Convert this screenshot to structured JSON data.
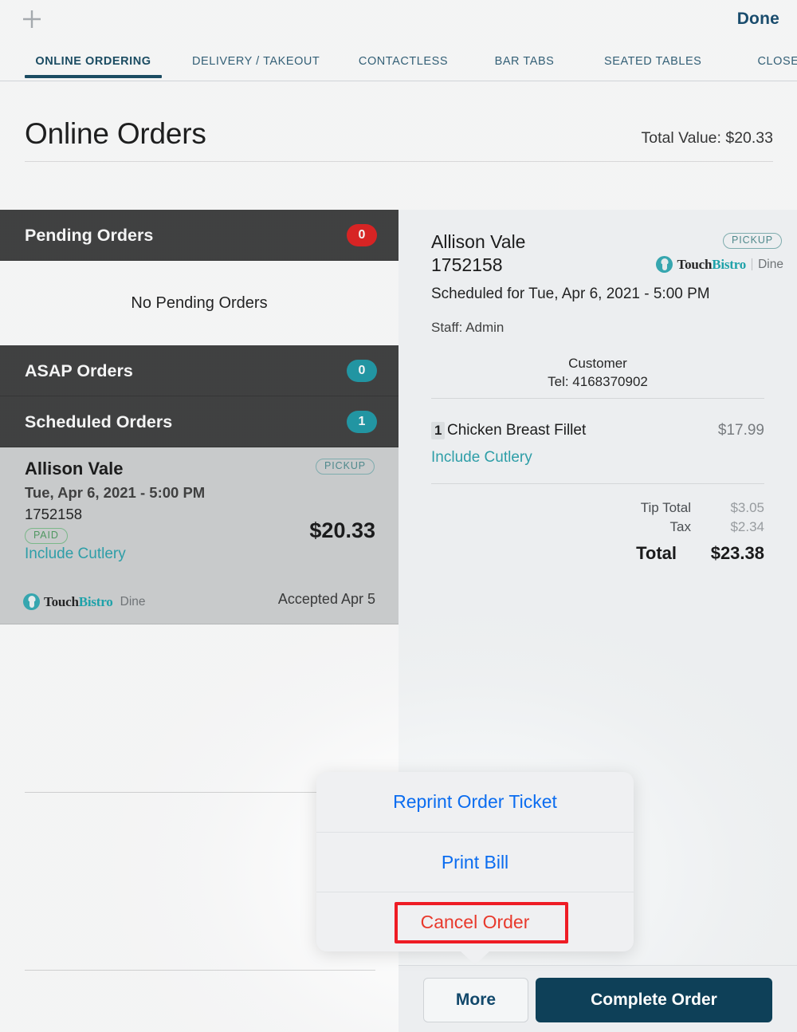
{
  "topbar": {
    "add_icon": "plus-icon",
    "done_label": "Done"
  },
  "tabs": [
    {
      "label": "ONLINE ORDERING",
      "active": true
    },
    {
      "label": "DELIVERY / TAKEOUT",
      "active": false
    },
    {
      "label": "CONTACTLESS",
      "active": false
    },
    {
      "label": "BAR TABS",
      "active": false
    },
    {
      "label": "SEATED TABLES",
      "active": false
    },
    {
      "label": "CLOSED",
      "active": false
    }
  ],
  "page": {
    "title": "Online Orders",
    "total_value": "Total Value: $20.33"
  },
  "sidebar": {
    "sections": [
      {
        "label": "Pending Orders",
        "count": "0",
        "badge_color": "#e01b1b"
      },
      {
        "label": "ASAP Orders",
        "count": "0",
        "badge_color": "#1a97a5"
      },
      {
        "label": "Scheduled Orders",
        "count": "1",
        "badge_color": "#1a97a5"
      }
    ],
    "empty_pending_text": "No Pending Orders",
    "order_card": {
      "name": "Allison Vale",
      "date": "Tue, Apr 6, 2021 - 5:00 PM",
      "order_number": "1752158",
      "pickup_badge": "PICKUP",
      "paid_badge": "PAID",
      "modifier": "Include Cutlery",
      "price": "$20.33",
      "brand": "TouchBistro",
      "brand_first": "Touch",
      "brand_second": "Bistro",
      "product": "Dine",
      "accepted": "Accepted Apr 5"
    }
  },
  "detail": {
    "name": "Allison Vale",
    "order_number": "1752158",
    "pickup_badge": "PICKUP",
    "brand_first": "Touch",
    "brand_second": "Bistro",
    "product": "Dine",
    "scheduled": "Scheduled for Tue, Apr 6, 2021 - 5:00 PM",
    "staff": "Staff: Admin",
    "customer_label": "Customer",
    "customer_tel": "Tel: 4168370902",
    "items": [
      {
        "qty": "1",
        "name": "Chicken Breast Fillet",
        "price": "$17.99",
        "modifier": "Include Cutlery"
      }
    ],
    "totals": [
      {
        "label": "Tip Total",
        "value": "$3.05"
      },
      {
        "label": "Tax",
        "value": "$2.34"
      }
    ],
    "grand_total_label": "Total",
    "grand_total_value": "$23.38"
  },
  "actions": {
    "more_label": "More",
    "complete_label": "Complete Order"
  },
  "popover": {
    "items": [
      {
        "label": "Reprint Order Ticket",
        "destructive": false
      },
      {
        "label": "Print Bill",
        "destructive": false
      },
      {
        "label": "Cancel Order",
        "destructive": true
      }
    ],
    "highlight_color": "#ee1c25"
  }
}
